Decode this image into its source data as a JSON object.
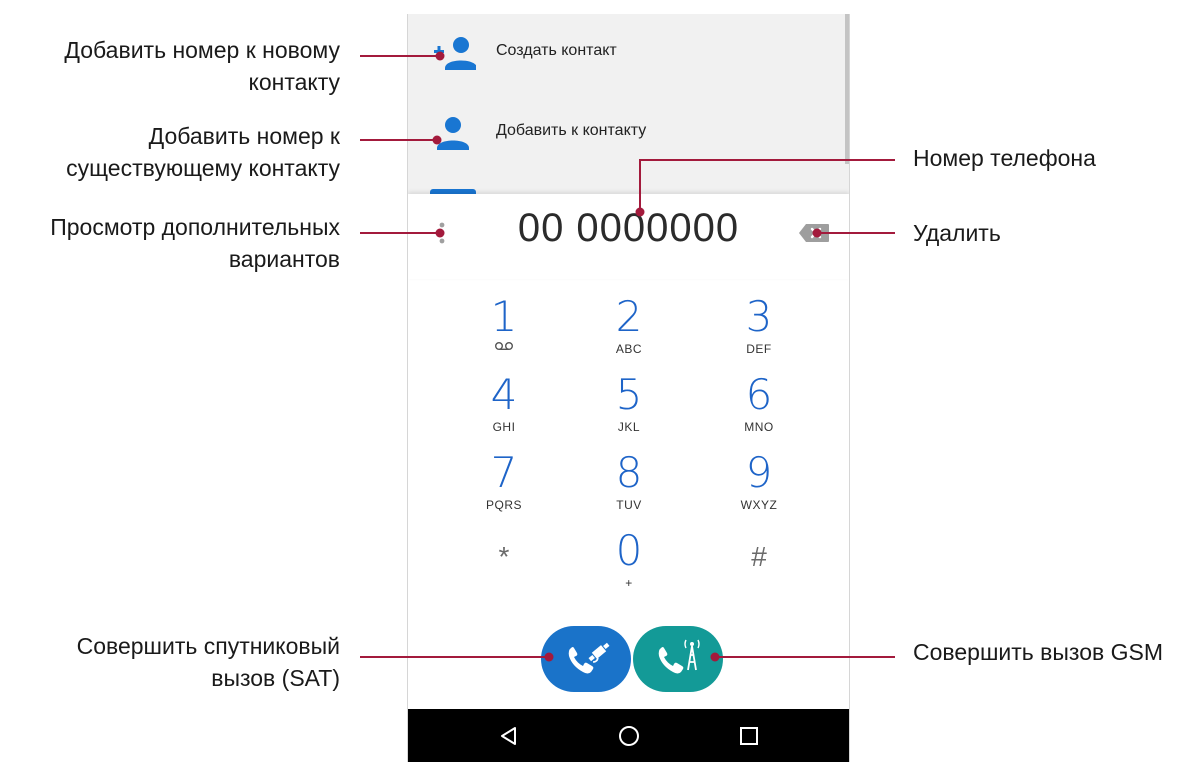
{
  "annotations": {
    "add_new_contact": [
      "Добавить номер к новому",
      "контакту"
    ],
    "add_existing_contact": [
      "Добавить номер к",
      "существующему контакту"
    ],
    "more_options": [
      "Просмотр дополнительных",
      "вариантов"
    ],
    "satellite_call": [
      "Совершить спутниковый",
      "вызов (SAT)"
    ],
    "phone_number": "Номер телефона",
    "delete": "Удалить",
    "gsm_call": "Совершить вызов GSM"
  },
  "suggestions": [
    {
      "label": "Создать контакт",
      "icon": "add-contact-icon"
    },
    {
      "label": "Добавить к контакту",
      "icon": "person-icon"
    }
  ],
  "dialer": {
    "number": "00 0000000",
    "keys": [
      {
        "digit": "1",
        "letters": "",
        "extra_icon": "voicemail-icon"
      },
      {
        "digit": "2",
        "letters": "ABC"
      },
      {
        "digit": "3",
        "letters": "DEF"
      },
      {
        "digit": "4",
        "letters": "GHI"
      },
      {
        "digit": "5",
        "letters": "JKL"
      },
      {
        "digit": "6",
        "letters": "MNO"
      },
      {
        "digit": "7",
        "letters": "PQRS"
      },
      {
        "digit": "8",
        "letters": "TUV"
      },
      {
        "digit": "9",
        "letters": "WXYZ"
      },
      {
        "digit": "*",
        "letters": ""
      },
      {
        "digit": "0",
        "letters": "+"
      },
      {
        "digit": "#",
        "letters": ""
      }
    ]
  },
  "colors": {
    "accent_blue": "#1976d2",
    "sat_button": "#1a73c9",
    "gsm_button": "#139a97",
    "leader_line": "#a31a3c"
  },
  "call_buttons": {
    "sat_icon": "satellite-call-icon",
    "gsm_icon": "gsm-tower-call-icon"
  },
  "nav": [
    "back-icon",
    "home-icon",
    "recents-icon"
  ]
}
